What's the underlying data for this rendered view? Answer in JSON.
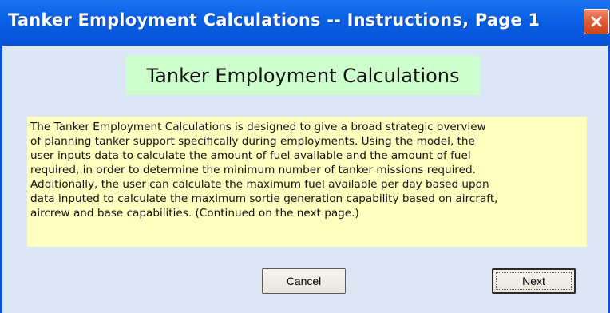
{
  "window": {
    "title": "Tanker Employment Calculations -- Instructions, Page 1",
    "close_icon": "close-x-icon"
  },
  "heading": "Tanker Employment Calculations",
  "instructions": {
    "lines": [
      "The Tanker Employment Calculations is designed to give a broad strategic overview",
      "of planning tanker support specifically during employments.  Using the model, the",
      "user inputs data to calculate the amount of fuel available and the amount of fuel",
      "required, in order to determine the minimum number of tanker missions required.",
      "Additionally, the user can calculate the maximum fuel available per day based upon",
      "data inputed to calculate the maximum sortie generation capability based on aircraft,",
      "aircrew and base capabilities.  (Continued on the next page.)"
    ]
  },
  "buttons": {
    "cancel": "Cancel",
    "next": "Next"
  },
  "colors": {
    "titlebar": "#0a5fe4",
    "close_button": "#e05a32",
    "background": "#dce6f4",
    "heading_bg": "#ccffcc",
    "instructions_bg": "#ffffc0"
  }
}
